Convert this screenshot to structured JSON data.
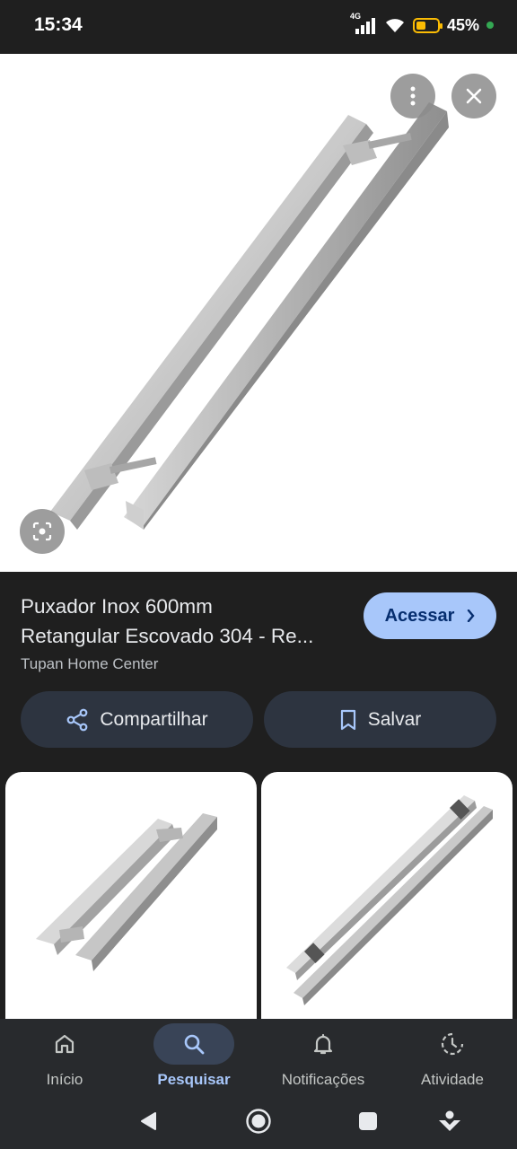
{
  "status": {
    "time": "15:34",
    "network": "4G",
    "battery": "45%",
    "icons": [
      "signal-icon",
      "wifi-icon",
      "battery-icon"
    ]
  },
  "hero": {
    "more_icon": "more-vert-icon",
    "close_icon": "close-icon",
    "lens_icon": "lens-icon",
    "image_subject": "stainless steel door pull handle"
  },
  "result": {
    "title_line1": "Puxador Inox 600mm",
    "title_line2": "Retangular Escovado 304 - Re...",
    "source": "Tupan Home Center",
    "visit_label": "Acessar",
    "visit_icon": "chevron-right-icon",
    "share_label": "Compartilhar",
    "share_icon": "share-icon",
    "save_label": "Salvar",
    "save_icon": "bookmark-icon"
  },
  "related": [
    {
      "subject": "stainless steel door pull handle"
    },
    {
      "subject": "stainless steel door pull handle"
    }
  ],
  "bottom_nav": {
    "items": [
      {
        "label": "Início",
        "icon": "home-icon",
        "active": false
      },
      {
        "label": "Pesquisar",
        "icon": "search-icon",
        "active": true
      },
      {
        "label": "Notificações",
        "icon": "bell-icon",
        "active": false
      },
      {
        "label": "Atividade",
        "icon": "activity-icon",
        "active": false
      }
    ]
  },
  "system_nav": {
    "icons": [
      "back-icon",
      "home-circle-icon",
      "recents-icon",
      "assistant-icon"
    ]
  },
  "colors": {
    "background": "#1f1f1f",
    "accent": "#a8c7fa",
    "button_bg": "#2d3440",
    "nav_bg": "#282a2d",
    "active_pill": "#394457"
  }
}
